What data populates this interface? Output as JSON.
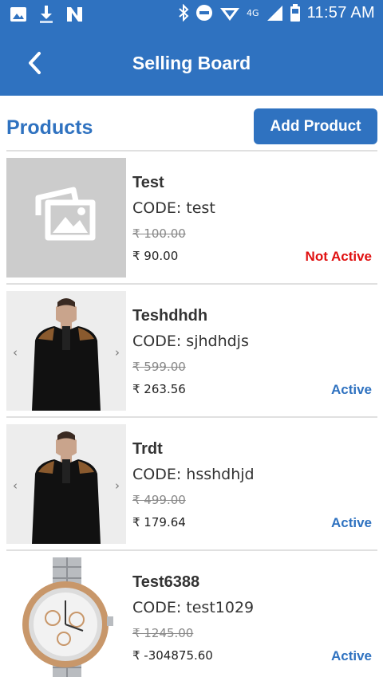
{
  "status_bar": {
    "network_type": "4G",
    "time": "11:57 AM"
  },
  "app_bar": {
    "title": "Selling Board",
    "back_icon": "chevron-left-icon"
  },
  "page": {
    "heading": "Products",
    "add_button_label": "Add Product"
  },
  "products": [
    {
      "name": "Test",
      "code": "CODE: test",
      "mrp": "₹ 100.00",
      "price": "₹ 90.00",
      "status": "Not Active",
      "image": "placeholder-image-icon"
    },
    {
      "name": "Teshdhdh",
      "code": "CODE: sjhdhdjs",
      "mrp": "₹ 599.00",
      "price": "₹ 263.56",
      "status": "Active",
      "image": "sweater-photo"
    },
    {
      "name": "Trdt",
      "code": "CODE: hsshdhjd",
      "mrp": "₹ 499.00",
      "price": "₹ 179.64",
      "status": "Active",
      "image": "sweater-photo"
    },
    {
      "name": "Test6388",
      "code": "CODE: test1029",
      "mrp": "₹ 1245.00",
      "price": "₹ -304875.60",
      "status": "Active",
      "image": "watch-photo"
    }
  ],
  "colors": {
    "primary": "#2f72c0",
    "inactive_status": "#e01010"
  }
}
